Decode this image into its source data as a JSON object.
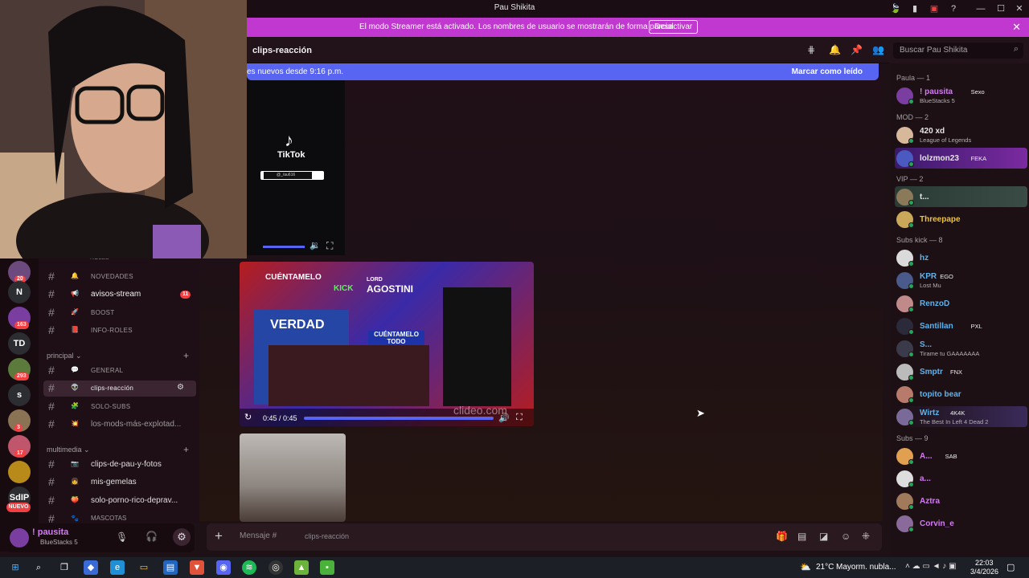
{
  "window": {
    "title": "Pau Shikita"
  },
  "streamer_bar": {
    "message": "El modo Streamer está activado. Los nombres de usuario se mostrarán de forma parcial.",
    "button": "Desactivar"
  },
  "channel_header": {
    "name": "clips-reacción",
    "search_placeholder": "Buscar Pau Shikita"
  },
  "new_bar": {
    "left": "es nuevos desde 9:16 p.m.",
    "right": "Marcar como leído"
  },
  "tiktok": {
    "label": "TikTok",
    "handle": "@_/au616"
  },
  "video": {
    "title_left": "CUÉNTAMELO",
    "kick": "KICK",
    "lord": "LORD",
    "agostini": "AGOSTINI",
    "verdad": "VERDAD",
    "cuentamelo_todo": "CUÉNTAMELO TODO",
    "time": "0:45 / 0:45",
    "watermark": "clideo.com"
  },
  "servers": [
    {
      "label": "",
      "badge": "20",
      "color": "#6d4a7d"
    },
    {
      "label": "N",
      "badge": "",
      "color": "#2b2d31"
    },
    {
      "label": "",
      "badge": "163",
      "color": "#7a3da0"
    },
    {
      "label": "TD",
      "badge": "",
      "color": "#2b2d31"
    },
    {
      "label": "",
      "badge": "293",
      "color": "#5b7a3b"
    },
    {
      "label": "s",
      "badge": "",
      "color": "#2b2d31"
    },
    {
      "label": "",
      "badge": "3",
      "color": "#8a7255"
    },
    {
      "label": "",
      "badge": "17",
      "color": "#c0566b"
    },
    {
      "label": "",
      "badge": "",
      "color": "#b88a1a"
    },
    {
      "label": "SdIP",
      "badge": "",
      "color": "#2b2d31"
    },
    {
      "label": "NUEVO",
      "badge": "",
      "color": "#f23f42"
    }
  ],
  "channels": {
    "roles": "ROLES",
    "items": [
      {
        "emoji": "🔔",
        "label": "NOVEDADES",
        "small": true,
        "badge": ""
      },
      {
        "emoji": "📢",
        "label": "avisos-stream",
        "small": false,
        "badge": "11",
        "bright": true
      },
      {
        "emoji": "🚀",
        "label": "BOOST",
        "small": true,
        "badge": ""
      },
      {
        "emoji": "📕",
        "label": "INFO-ROLES",
        "small": true,
        "badge": ""
      }
    ],
    "category1": "principal",
    "items2": [
      {
        "emoji": "💬",
        "label": "GENERAL",
        "small": true
      },
      {
        "emoji": "👽",
        "label": "clips-reacción",
        "small": true,
        "active": true
      },
      {
        "emoji": "🧩",
        "label": "SOLO-SUBS",
        "small": true
      },
      {
        "emoji": "💥",
        "label": "los-mods-más-explotad...",
        "small": false
      }
    ],
    "category2": "multimedia",
    "items3": [
      {
        "emoji": "📷",
        "label": "clips-de-pau-y-fotos"
      },
      {
        "emoji": "👧",
        "label": "mis-gemelas"
      },
      {
        "emoji": "🍑",
        "label": "solo-porno-rico-deprav..."
      },
      {
        "emoji": "🐾",
        "label": "MASCOTAS"
      }
    ]
  },
  "user_panel": {
    "name": "! pausita",
    "status": "BlueStacks 5"
  },
  "composer": {
    "placeholder": "Mensaje #",
    "channel": "clips-reacción"
  },
  "members": {
    "groups": [
      {
        "title": "Paula — 1",
        "members": [
          {
            "name": "! pausita",
            "tag": "Sexo",
            "status": "BlueStacks 5",
            "color": "#d27cf0"
          }
        ]
      },
      {
        "title": "MOD — 2",
        "members": [
          {
            "name": "420 xd",
            "tag": "",
            "status": "League of Legends",
            "color": "#e6e6e6"
          },
          {
            "name": "lolzmon23",
            "tag": "FEKA",
            "status": "",
            "color": "#e6e6e6"
          }
        ]
      },
      {
        "title": "VIP — 2",
        "members": [
          {
            "name": "t...",
            "tag": "",
            "status": "",
            "color": "#e6e6e6"
          },
          {
            "name": "Threepape",
            "tag": "",
            "status": "",
            "color": "#f1c232"
          }
        ]
      },
      {
        "title": "Subs kick — 8",
        "members": [
          {
            "name": "hz",
            "tag": "",
            "status": "",
            "color": "#5ab4f0"
          },
          {
            "name": "KPR",
            "tag": "EGO",
            "status": "Lost Mu",
            "color": "#5ab4f0"
          },
          {
            "name": "RenzoD",
            "tag": "",
            "status": "",
            "color": "#5ab4f0"
          },
          {
            "name": "Santillan",
            "tag": "PXL",
            "status": "",
            "color": "#5ab4f0"
          },
          {
            "name": "S...",
            "tag": "",
            "status": "Tirame tu GAAAAAAA",
            "color": "#5ab4f0"
          },
          {
            "name": "Smptr",
            "tag": "FNX",
            "status": "",
            "color": "#5ab4f0"
          },
          {
            "name": "topito bear",
            "tag": "",
            "status": "",
            "color": "#5ab4f0"
          },
          {
            "name": "Wirtz",
            "tag": "4K4K",
            "status": "The Best In Left 4 Dead 2",
            "color": "#5ab4f0"
          }
        ]
      },
      {
        "title": "Subs — 9",
        "members": [
          {
            "name": "A...",
            "tag": "SAB",
            "status": "",
            "color": "#d27cf0"
          },
          {
            "name": "a...",
            "tag": "",
            "status": "",
            "color": "#d27cf0"
          },
          {
            "name": "Aztra",
            "tag": "",
            "status": "",
            "color": "#d27cf0"
          },
          {
            "name": "Corvin_e",
            "tag": "",
            "status": "",
            "color": "#d27cf0"
          }
        ]
      }
    ]
  },
  "taskbar": {
    "weather": "21°C",
    "weather_desc": "Mayorm. nubla...",
    "time": "22:03",
    "date": "3/4/2026"
  }
}
